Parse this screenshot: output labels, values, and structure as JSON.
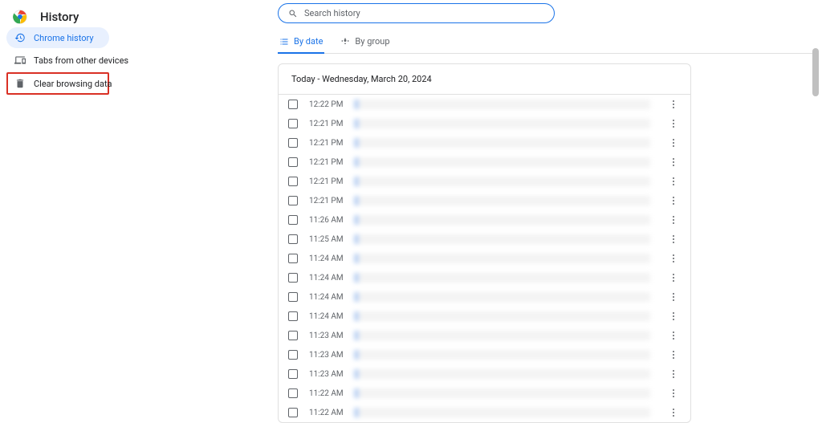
{
  "header": {
    "title": "History"
  },
  "sidebar": {
    "items": [
      {
        "label": "Chrome history",
        "icon": "history-icon"
      },
      {
        "label": "Tabs from other devices",
        "icon": "devices-icon"
      },
      {
        "label": "Clear browsing data",
        "icon": "trash-icon"
      }
    ]
  },
  "search": {
    "placeholder": "Search history"
  },
  "tabs": [
    {
      "label": "By date",
      "icon": "list-icon"
    },
    {
      "label": "By group",
      "icon": "group-icon"
    }
  ],
  "card": {
    "header": "Today - Wednesday, March 20, 2024",
    "entries": [
      {
        "time": "12:22 PM"
      },
      {
        "time": "12:21 PM"
      },
      {
        "time": "12:21 PM"
      },
      {
        "time": "12:21 PM"
      },
      {
        "time": "12:21 PM"
      },
      {
        "time": "12:21 PM"
      },
      {
        "time": "11:26 AM"
      },
      {
        "time": "11:25 AM"
      },
      {
        "time": "11:24 AM"
      },
      {
        "time": "11:24 AM"
      },
      {
        "time": "11:24 AM"
      },
      {
        "time": "11:24 AM"
      },
      {
        "time": "11:23 AM"
      },
      {
        "time": "11:23 AM"
      },
      {
        "time": "11:23 AM"
      },
      {
        "time": "11:22 AM"
      },
      {
        "time": "11:22 AM"
      }
    ]
  }
}
